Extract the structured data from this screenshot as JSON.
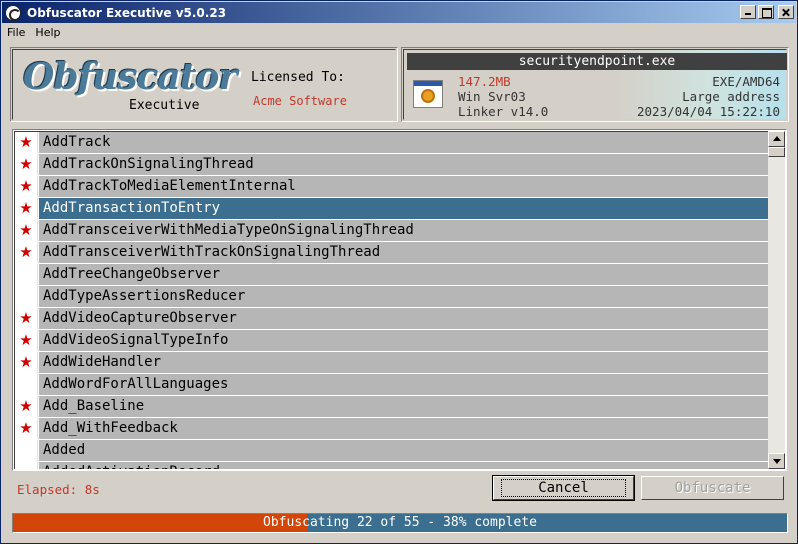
{
  "window": {
    "title": "Obfuscator Executive v5.0.23",
    "icon": "app-icon"
  },
  "menu": {
    "items": [
      "File",
      "Help"
    ]
  },
  "header": {
    "logo_text": "Obfuscator",
    "logo_sub": "Executive",
    "licensed_label": "Licensed To:",
    "licensee": "Acme Software"
  },
  "file": {
    "name": "securityendpoint.exe",
    "icon": "executable-file-icon",
    "size": "147.2MB",
    "os": "Win Svr03",
    "linker": "Linker v14.0",
    "arch": "EXE/AMD64",
    "address": "Large address",
    "timestamp": "2023/04/04 15:22:10"
  },
  "list": {
    "items": [
      {
        "label": "AddTrack",
        "starred": true,
        "selected": false
      },
      {
        "label": "AddTrackOnSignalingThread",
        "starred": true,
        "selected": false
      },
      {
        "label": "AddTrackToMediaElementInternal",
        "starred": true,
        "selected": false
      },
      {
        "label": "AddTransactionToEntry",
        "starred": true,
        "selected": true
      },
      {
        "label": "AddTransceiverWithMediaTypeOnSignalingThread",
        "starred": true,
        "selected": false
      },
      {
        "label": "AddTransceiverWithTrackOnSignalingThread",
        "starred": true,
        "selected": false
      },
      {
        "label": "AddTreeChangeObserver",
        "starred": false,
        "selected": false
      },
      {
        "label": "AddTypeAssertionsReducer",
        "starred": false,
        "selected": false
      },
      {
        "label": "AddVideoCaptureObserver",
        "starred": true,
        "selected": false
      },
      {
        "label": "AddVideoSignalTypeInfo",
        "starred": true,
        "selected": false
      },
      {
        "label": "AddWideHandler",
        "starred": true,
        "selected": false
      },
      {
        "label": "AddWordForAllLanguages",
        "starred": false,
        "selected": false
      },
      {
        "label": "Add_Baseline",
        "starred": true,
        "selected": false
      },
      {
        "label": "Add_WithFeedback",
        "starred": true,
        "selected": false
      },
      {
        "label": "Added",
        "starred": false,
        "selected": false
      },
      {
        "label": "AddedActivationRecord",
        "starred": false,
        "selected": false
      }
    ],
    "star_glyph": "★",
    "star_color": "#d00000",
    "selected_color": "#3b6e8f"
  },
  "footer": {
    "elapsed": "Elapsed: 8s",
    "cancel_label": "Cancel",
    "obfuscate_label": "Obfuscate",
    "progress_text": "Obfuscating 22 of 55 - 38% complete",
    "progress_fraction": 0.38,
    "progress_color": "#d2460a"
  }
}
